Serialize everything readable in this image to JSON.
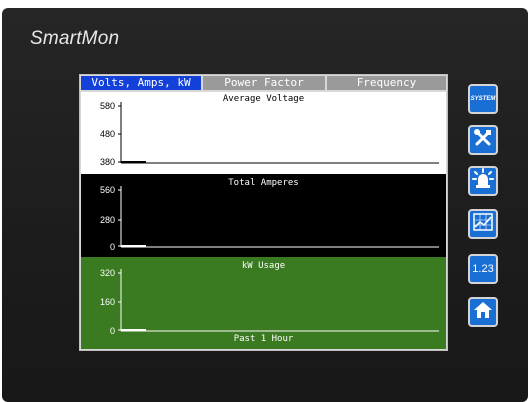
{
  "brand": {
    "logo": "SmartMon"
  },
  "tabs": [
    {
      "label": "Volts, Amps, kW",
      "active": true
    },
    {
      "label": "Power Factor",
      "active": false
    },
    {
      "label": "Frequency",
      "active": false
    }
  ],
  "charts": {
    "voltage": {
      "title": "Average Voltage",
      "yticks": [
        "580",
        "480",
        "380"
      ]
    },
    "amperes": {
      "title": "Total Amperes",
      "yticks": [
        "560",
        "280",
        "0"
      ]
    },
    "kw": {
      "title": "kW Usage",
      "yticks": [
        "320",
        "160",
        "0"
      ],
      "xlabel": "Past 1 Hour"
    }
  },
  "sidebar": {
    "system_label": "SYSTEM",
    "number_label": "1.23",
    "icons": [
      "system-icon",
      "tools-icon",
      "alarm-icon",
      "trend-chart-icon",
      "numeric-icon",
      "home-icon"
    ]
  },
  "colors": {
    "tab_active": "#1340d8",
    "tab_inactive": "#9a9a9a",
    "button_blue": "#1a6fd4",
    "kw_panel": "#3a7a20"
  }
}
